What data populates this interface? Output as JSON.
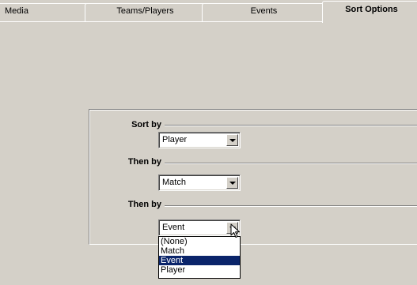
{
  "tabs": [
    {
      "label": "Media",
      "active": false
    },
    {
      "label": "Teams/Players",
      "active": false
    },
    {
      "label": "Events",
      "active": false
    },
    {
      "label": "Sort Options",
      "active": true
    }
  ],
  "sort": {
    "sort_by_label": "Sort by",
    "sort_by_value": "Player",
    "then_by_1_label": "Then by",
    "then_by_1_value": "Match",
    "then_by_2_label": "Then by",
    "then_by_2_value": "Event"
  },
  "dropdown": {
    "options": [
      "(None)",
      "Match",
      "Event",
      "Player"
    ],
    "selected": "Event"
  },
  "colors": {
    "background": "#d4d0c8",
    "selection": "#0a246a"
  },
  "icons": {
    "combo_arrow": "chevron-down-icon",
    "cursor": "mouse-pointer-icon"
  }
}
